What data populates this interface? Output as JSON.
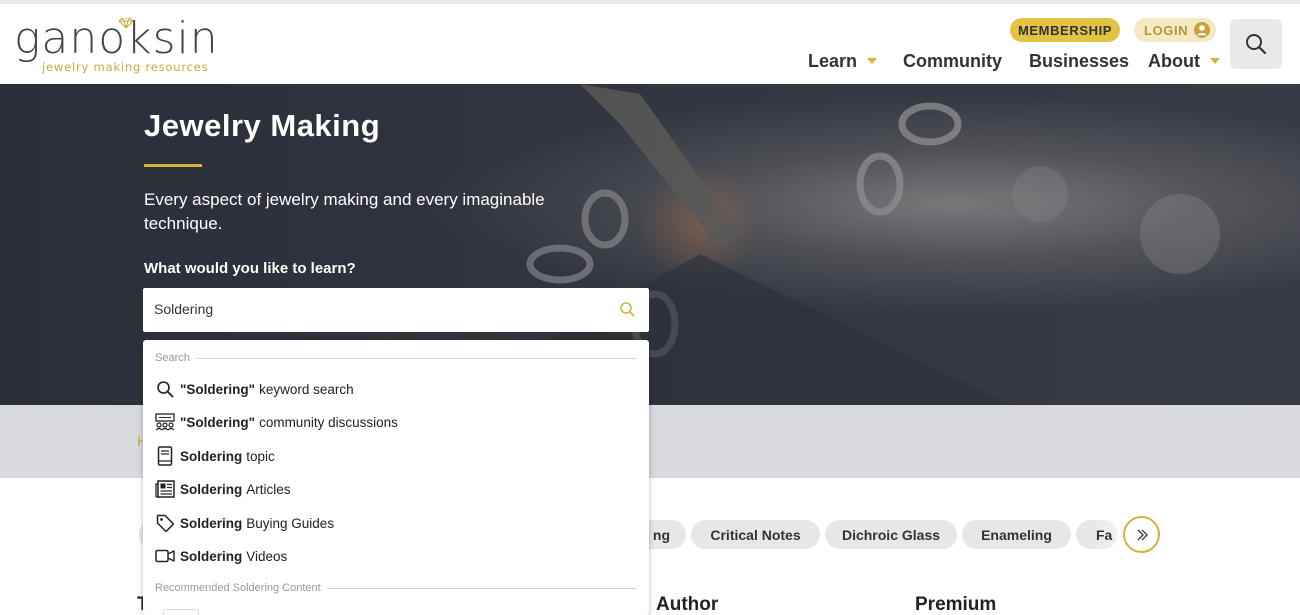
{
  "header": {
    "logo_text": "ganoksin",
    "logo_tagline": "jewelry making resources",
    "membership_label": "MEMBERSHIP",
    "login_label": "LOGIN",
    "nav": [
      {
        "label": "Learn"
      },
      {
        "label": "Community"
      },
      {
        "label": "Businesses"
      },
      {
        "label": "About"
      }
    ]
  },
  "hero": {
    "title": "Jewelry Making",
    "description": "Every aspect of jewelry making and every imaginable technique.",
    "question": "What would you like to learn?",
    "search_value": "Soldering"
  },
  "dropdown": {
    "section_search": "Search",
    "items": [
      {
        "strong": "\"Soldering\"",
        "rest": "keyword search",
        "icon": "search-icon"
      },
      {
        "strong": "\"Soldering\"",
        "rest": "community discussions",
        "icon": "community-icon"
      },
      {
        "strong": "Soldering",
        "rest": "topic",
        "icon": "book-icon"
      },
      {
        "strong": "Soldering",
        "rest": "Articles",
        "icon": "newspaper-icon"
      },
      {
        "strong": "Soldering",
        "rest": "Buying Guides",
        "icon": "tag-icon"
      },
      {
        "strong": "Soldering",
        "rest": "Videos",
        "icon": "video-icon"
      }
    ],
    "section_recommended": "Recommended Soldering Content"
  },
  "breadcrumb": {
    "first_char": "H"
  },
  "chips": {
    "partial": "ng",
    "items": [
      "Critical Notes",
      "Dichroic Glass",
      "Enameling"
    ],
    "faded": "Fa"
  },
  "columns": {
    "first_char": "T",
    "author": "Author",
    "premium": "Premium"
  },
  "colors": {
    "accent_gold": "#d4b23c",
    "membership_bg": "#e2c343",
    "gray_band": "#d7d9dc"
  }
}
